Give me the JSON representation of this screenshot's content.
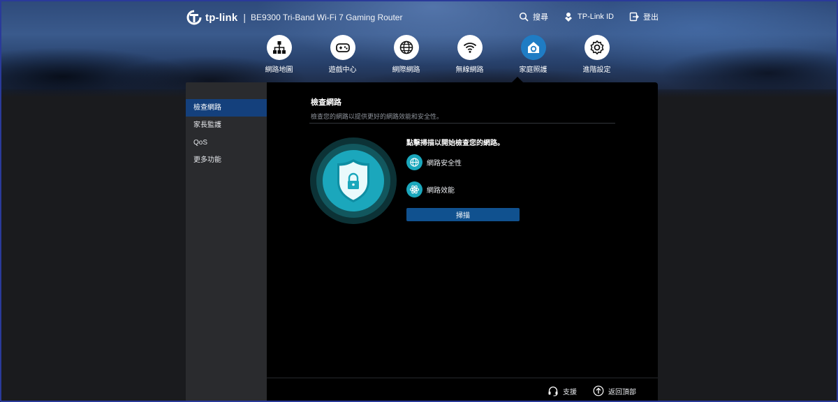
{
  "header": {
    "brand": "tp-link",
    "separator": "|",
    "product": "BE9300 Tri-Band Wi-Fi 7 Gaming Router",
    "actions": [
      {
        "label": "搜尋",
        "icon": "search-icon"
      },
      {
        "label": "TP-Link ID",
        "icon": "tplink-id-icon"
      },
      {
        "label": "登出",
        "icon": "logout-icon"
      }
    ]
  },
  "nav": {
    "items": [
      {
        "label": "網路地圖",
        "icon": "network-map-icon",
        "active": false
      },
      {
        "label": "遊戲中心",
        "icon": "gamepad-icon",
        "active": false
      },
      {
        "label": "網際網路",
        "icon": "globe-icon",
        "active": false
      },
      {
        "label": "無線網路",
        "icon": "wifi-icon",
        "active": false
      },
      {
        "label": "家庭照護",
        "icon": "home-care-icon",
        "active": true
      },
      {
        "label": "進階設定",
        "icon": "gear-icon",
        "active": false
      }
    ]
  },
  "sidebar": {
    "items": [
      {
        "label": "檢查網路",
        "active": true
      },
      {
        "label": "家長監護",
        "active": false
      },
      {
        "label": "QoS",
        "active": false
      },
      {
        "label": "更多功能",
        "active": false
      }
    ]
  },
  "main": {
    "title": "檢查網路",
    "subtitle": "檢查您的網路以提供更好的網路效能和安全性。",
    "prompt": "點擊掃描以開始檢查您的網路。",
    "features": [
      {
        "label": "網路安全性",
        "icon": "globe-icon"
      },
      {
        "label": "網路效能",
        "icon": "atom-icon"
      }
    ],
    "scan_button": "掃描"
  },
  "footer": {
    "support": "支援",
    "back_to_top": "返回頂部"
  },
  "colors": {
    "accent": "#1f7cc4",
    "sidebar_active": "#14407c",
    "scan_button": "#10518f",
    "feature_icon": "#1ba7bc"
  }
}
